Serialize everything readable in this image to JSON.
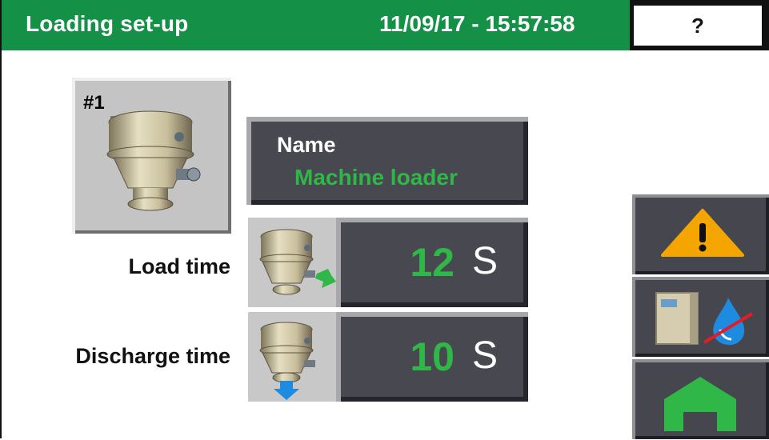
{
  "header": {
    "title": "Loading set-up",
    "datetime": "11/09/17 - 15:57:58",
    "help_label": "?"
  },
  "loader": {
    "number": "#1",
    "icon": "vacuum-loader-icon"
  },
  "name_panel": {
    "label": "Name",
    "value": "Machine loader"
  },
  "rows": [
    {
      "label": "Load time",
      "value": "12",
      "unit": "S",
      "icon": "loader-load-icon"
    },
    {
      "label": "Discharge time",
      "value": "10",
      "unit": "S",
      "icon": "loader-discharge-icon"
    }
  ],
  "side_buttons": [
    {
      "name": "alarm",
      "icon": "warning-icon"
    },
    {
      "name": "dryer-water",
      "icon": "dryer-no-water-icon"
    },
    {
      "name": "home",
      "icon": "home-icon"
    }
  ],
  "colors": {
    "header_green": "#149146",
    "value_green": "#2fb748",
    "panel_dark": "#474850",
    "warning_orange": "#f5a500",
    "home_green": "#2fb748",
    "water_blue": "#1c8be0"
  }
}
